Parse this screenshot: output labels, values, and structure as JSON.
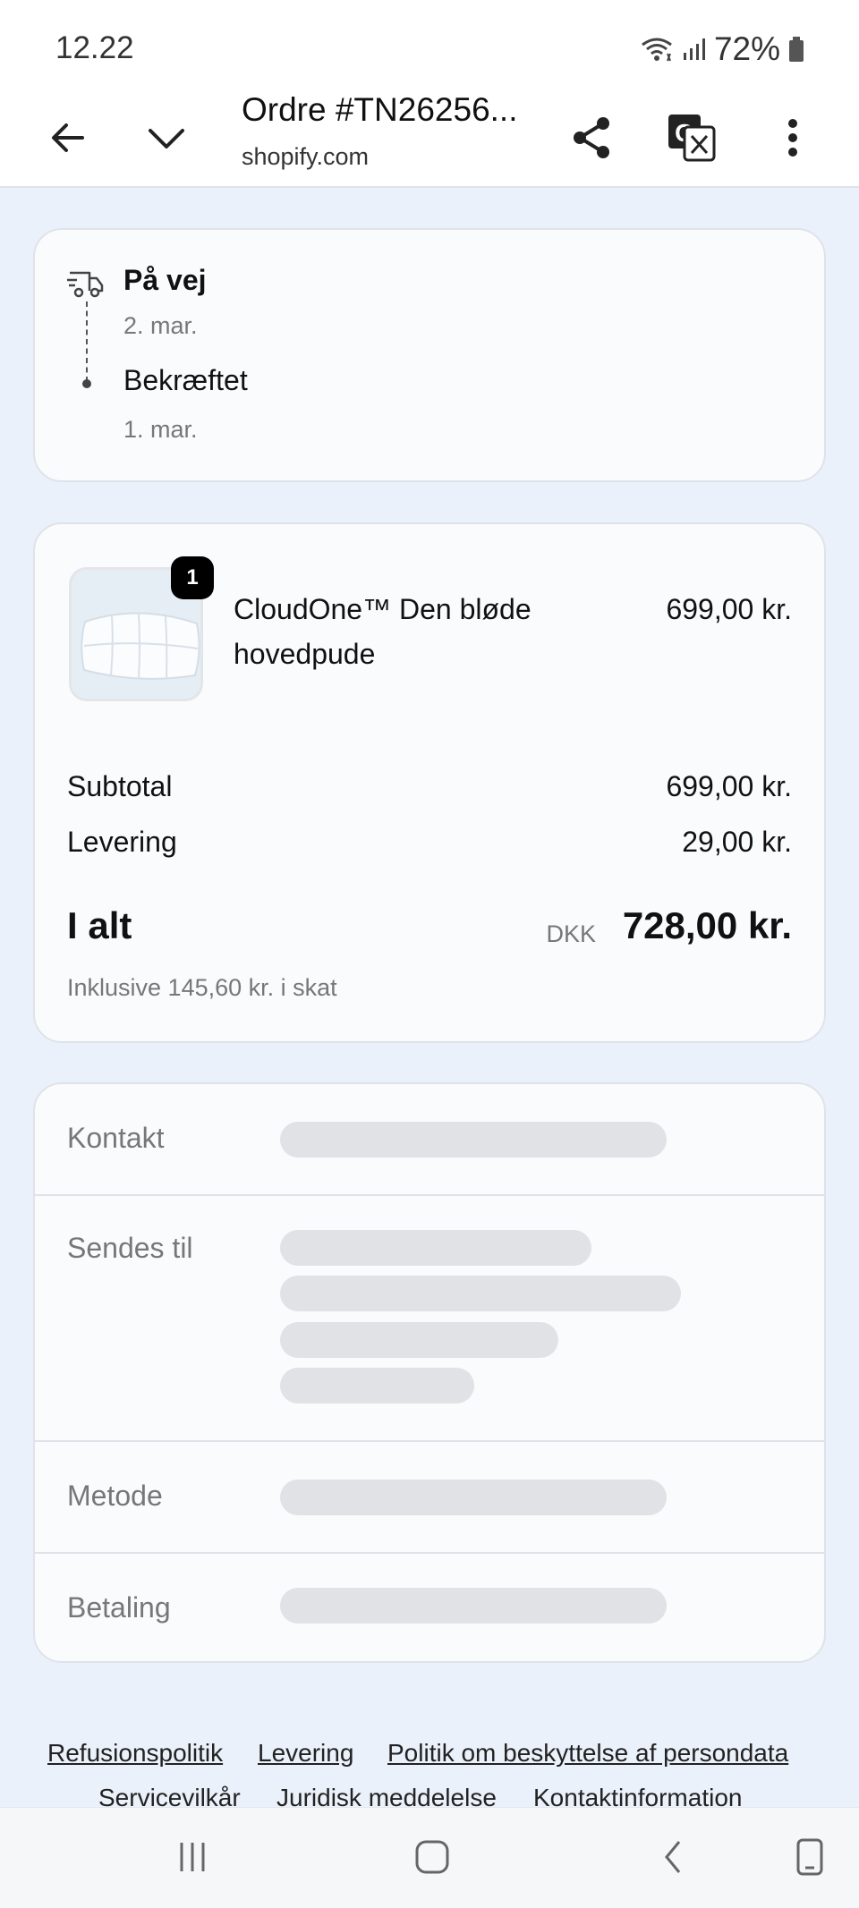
{
  "status_bar": {
    "time": "12.22",
    "battery": "72%"
  },
  "toolbar": {
    "title": "Ordre #TN26256...",
    "domain": "shopify.com"
  },
  "timeline": {
    "current_status": "På vej",
    "current_date": "2. mar.",
    "previous_status": "Bekræftet",
    "previous_date": "1. mar."
  },
  "order": {
    "item": {
      "quantity": "1",
      "name": "CloudOne™ Den bløde hovedpude",
      "price": "699,00 kr."
    },
    "subtotal_label": "Subtotal",
    "subtotal_value": "699,00 kr.",
    "shipping_label": "Levering",
    "shipping_value": "29,00 kr.",
    "total_label": "I alt",
    "currency": "DKK",
    "total_value": "728,00 kr.",
    "tax_note": "Inklusive 145,60 kr. i skat"
  },
  "info": {
    "contact_label": "Kontakt",
    "ship_to_label": "Sendes til",
    "method_label": "Metode",
    "payment_label": "Betaling"
  },
  "footer": {
    "links_row1": [
      "Refusionspolitik",
      "Levering",
      "Politik om beskyttelse af persondata"
    ],
    "links_row2": [
      "Servicevilkår",
      "Juridisk meddelelse",
      "Kontaktinformation"
    ]
  }
}
